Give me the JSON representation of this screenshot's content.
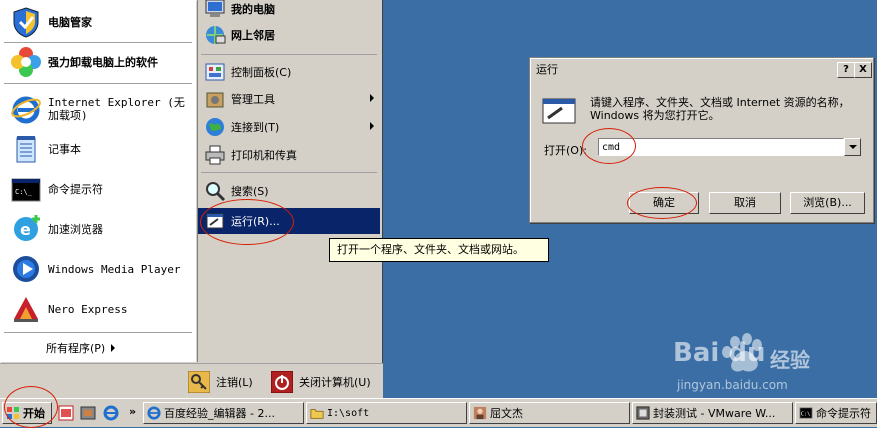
{
  "start_menu": {
    "left_items": [
      {
        "label": "电脑管家",
        "icon": "shield-icon",
        "bold": true
      },
      {
        "label": "强力卸载电脑上的软件",
        "icon": "flower-icon",
        "bold": true
      },
      {
        "label": "Internet Explorer (无加载项)",
        "icon": "ie-icon"
      },
      {
        "label": "记事本",
        "icon": "notepad-icon"
      },
      {
        "label": "命令提示符",
        "icon": "cmd-icon"
      },
      {
        "label": "加速浏览器",
        "icon": "browser-icon"
      },
      {
        "label": "Windows Media Player",
        "icon": "media-player-icon"
      },
      {
        "label": "Nero Express",
        "icon": "nero-icon"
      }
    ],
    "all_programs": "所有程序(P)",
    "right_items": [
      {
        "label": "我的电脑",
        "icon": "computer-icon"
      },
      {
        "label": "网上邻居",
        "icon": "network-icon"
      },
      {
        "label": "控制面板(C)",
        "icon": "control-panel-icon"
      },
      {
        "label": "管理工具",
        "icon": "admin-tools-icon",
        "submenu": true
      },
      {
        "label": "连接到(T)",
        "icon": "globe-icon",
        "submenu": true
      },
      {
        "label": "打印机和传真",
        "icon": "printer-icon"
      },
      {
        "label": "搜索(S)",
        "icon": "search-icon"
      },
      {
        "label": "运行(R)...",
        "icon": "run-icon",
        "highlighted": true
      }
    ],
    "logoff": "注销(L)",
    "shutdown": "关闭计算机(U)"
  },
  "tooltip": "打开一个程序、文件夹、文档或网站。",
  "run_dialog": {
    "title": "运行",
    "help_btn": "?",
    "close_btn": "X",
    "description": "请键入程序、文件夹、文档或 Internet 资源的名称，Windows 将为您打开它。",
    "open_label": "打开(O):",
    "input_value": "cmd",
    "ok": "确定",
    "cancel": "取消",
    "browse": "浏览(B)..."
  },
  "taskbar": {
    "start": "开始",
    "more": "»",
    "tasks": [
      {
        "label": "百度经验_编辑器 - 2...",
        "icon": "ie-icon"
      },
      {
        "label": "I:\\soft",
        "icon": "folder-icon"
      },
      {
        "label": "屈文杰",
        "icon": "user-icon"
      },
      {
        "label": "封装测试 - VMware W...",
        "icon": "vmware-icon"
      },
      {
        "label": "命令提示符",
        "icon": "cmd-icon"
      }
    ]
  },
  "watermark": {
    "brand": "Bai du",
    "sub": "经验",
    "url": "jingyan.baidu.com"
  },
  "colors": {
    "desktop": "#3a6ea5",
    "highlight": "#0a246a",
    "annotation": "#d81e06"
  }
}
